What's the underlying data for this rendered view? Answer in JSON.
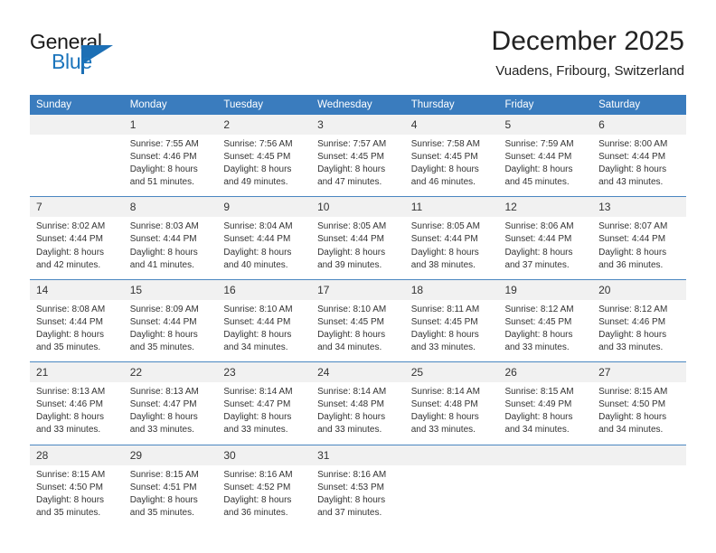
{
  "logo": {
    "word1": "General",
    "word2": "Blue",
    "icon": "triangle-flag-icon",
    "accent_color": "#1c6fb5"
  },
  "header": {
    "title": "December 2025",
    "subtitle": "Vuadens, Fribourg, Switzerland"
  },
  "calendar": {
    "header_bg": "#3a7cbe",
    "daynum_bg": "#f1f1f1",
    "weekdays": [
      "Sunday",
      "Monday",
      "Tuesday",
      "Wednesday",
      "Thursday",
      "Friday",
      "Saturday"
    ],
    "weeks": [
      [
        {
          "day": "",
          "lines": []
        },
        {
          "day": "1",
          "lines": [
            "Sunrise: 7:55 AM",
            "Sunset: 4:46 PM",
            "Daylight: 8 hours",
            "and 51 minutes."
          ]
        },
        {
          "day": "2",
          "lines": [
            "Sunrise: 7:56 AM",
            "Sunset: 4:45 PM",
            "Daylight: 8 hours",
            "and 49 minutes."
          ]
        },
        {
          "day": "3",
          "lines": [
            "Sunrise: 7:57 AM",
            "Sunset: 4:45 PM",
            "Daylight: 8 hours",
            "and 47 minutes."
          ]
        },
        {
          "day": "4",
          "lines": [
            "Sunrise: 7:58 AM",
            "Sunset: 4:45 PM",
            "Daylight: 8 hours",
            "and 46 minutes."
          ]
        },
        {
          "day": "5",
          "lines": [
            "Sunrise: 7:59 AM",
            "Sunset: 4:44 PM",
            "Daylight: 8 hours",
            "and 45 minutes."
          ]
        },
        {
          "day": "6",
          "lines": [
            "Sunrise: 8:00 AM",
            "Sunset: 4:44 PM",
            "Daylight: 8 hours",
            "and 43 minutes."
          ]
        }
      ],
      [
        {
          "day": "7",
          "lines": [
            "Sunrise: 8:02 AM",
            "Sunset: 4:44 PM",
            "Daylight: 8 hours",
            "and 42 minutes."
          ]
        },
        {
          "day": "8",
          "lines": [
            "Sunrise: 8:03 AM",
            "Sunset: 4:44 PM",
            "Daylight: 8 hours",
            "and 41 minutes."
          ]
        },
        {
          "day": "9",
          "lines": [
            "Sunrise: 8:04 AM",
            "Sunset: 4:44 PM",
            "Daylight: 8 hours",
            "and 40 minutes."
          ]
        },
        {
          "day": "10",
          "lines": [
            "Sunrise: 8:05 AM",
            "Sunset: 4:44 PM",
            "Daylight: 8 hours",
            "and 39 minutes."
          ]
        },
        {
          "day": "11",
          "lines": [
            "Sunrise: 8:05 AM",
            "Sunset: 4:44 PM",
            "Daylight: 8 hours",
            "and 38 minutes."
          ]
        },
        {
          "day": "12",
          "lines": [
            "Sunrise: 8:06 AM",
            "Sunset: 4:44 PM",
            "Daylight: 8 hours",
            "and 37 minutes."
          ]
        },
        {
          "day": "13",
          "lines": [
            "Sunrise: 8:07 AM",
            "Sunset: 4:44 PM",
            "Daylight: 8 hours",
            "and 36 minutes."
          ]
        }
      ],
      [
        {
          "day": "14",
          "lines": [
            "Sunrise: 8:08 AM",
            "Sunset: 4:44 PM",
            "Daylight: 8 hours",
            "and 35 minutes."
          ]
        },
        {
          "day": "15",
          "lines": [
            "Sunrise: 8:09 AM",
            "Sunset: 4:44 PM",
            "Daylight: 8 hours",
            "and 35 minutes."
          ]
        },
        {
          "day": "16",
          "lines": [
            "Sunrise: 8:10 AM",
            "Sunset: 4:44 PM",
            "Daylight: 8 hours",
            "and 34 minutes."
          ]
        },
        {
          "day": "17",
          "lines": [
            "Sunrise: 8:10 AM",
            "Sunset: 4:45 PM",
            "Daylight: 8 hours",
            "and 34 minutes."
          ]
        },
        {
          "day": "18",
          "lines": [
            "Sunrise: 8:11 AM",
            "Sunset: 4:45 PM",
            "Daylight: 8 hours",
            "and 33 minutes."
          ]
        },
        {
          "day": "19",
          "lines": [
            "Sunrise: 8:12 AM",
            "Sunset: 4:45 PM",
            "Daylight: 8 hours",
            "and 33 minutes."
          ]
        },
        {
          "day": "20",
          "lines": [
            "Sunrise: 8:12 AM",
            "Sunset: 4:46 PM",
            "Daylight: 8 hours",
            "and 33 minutes."
          ]
        }
      ],
      [
        {
          "day": "21",
          "lines": [
            "Sunrise: 8:13 AM",
            "Sunset: 4:46 PM",
            "Daylight: 8 hours",
            "and 33 minutes."
          ]
        },
        {
          "day": "22",
          "lines": [
            "Sunrise: 8:13 AM",
            "Sunset: 4:47 PM",
            "Daylight: 8 hours",
            "and 33 minutes."
          ]
        },
        {
          "day": "23",
          "lines": [
            "Sunrise: 8:14 AM",
            "Sunset: 4:47 PM",
            "Daylight: 8 hours",
            "and 33 minutes."
          ]
        },
        {
          "day": "24",
          "lines": [
            "Sunrise: 8:14 AM",
            "Sunset: 4:48 PM",
            "Daylight: 8 hours",
            "and 33 minutes."
          ]
        },
        {
          "day": "25",
          "lines": [
            "Sunrise: 8:14 AM",
            "Sunset: 4:48 PM",
            "Daylight: 8 hours",
            "and 33 minutes."
          ]
        },
        {
          "day": "26",
          "lines": [
            "Sunrise: 8:15 AM",
            "Sunset: 4:49 PM",
            "Daylight: 8 hours",
            "and 34 minutes."
          ]
        },
        {
          "day": "27",
          "lines": [
            "Sunrise: 8:15 AM",
            "Sunset: 4:50 PM",
            "Daylight: 8 hours",
            "and 34 minutes."
          ]
        }
      ],
      [
        {
          "day": "28",
          "lines": [
            "Sunrise: 8:15 AM",
            "Sunset: 4:50 PM",
            "Daylight: 8 hours",
            "and 35 minutes."
          ]
        },
        {
          "day": "29",
          "lines": [
            "Sunrise: 8:15 AM",
            "Sunset: 4:51 PM",
            "Daylight: 8 hours",
            "and 35 minutes."
          ]
        },
        {
          "day": "30",
          "lines": [
            "Sunrise: 8:16 AM",
            "Sunset: 4:52 PM",
            "Daylight: 8 hours",
            "and 36 minutes."
          ]
        },
        {
          "day": "31",
          "lines": [
            "Sunrise: 8:16 AM",
            "Sunset: 4:53 PM",
            "Daylight: 8 hours",
            "and 37 minutes."
          ]
        },
        {
          "day": "",
          "lines": []
        },
        {
          "day": "",
          "lines": []
        },
        {
          "day": "",
          "lines": []
        }
      ]
    ]
  }
}
